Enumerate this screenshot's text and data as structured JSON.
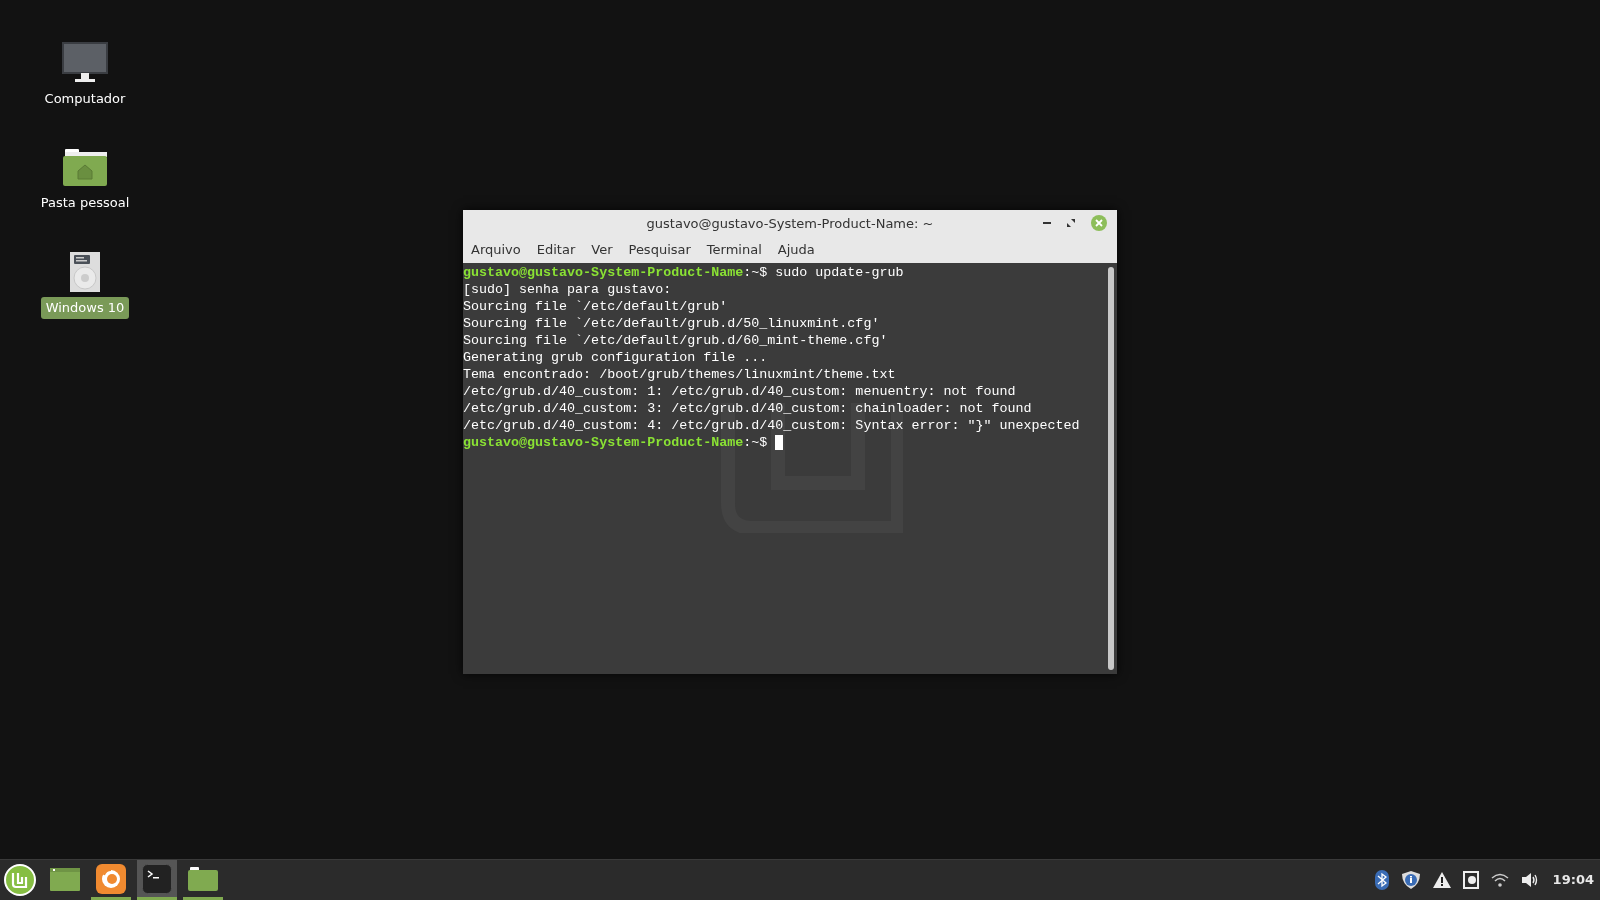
{
  "desktop_icons": [
    {
      "kind": "computer",
      "label": "Computador",
      "selected": false
    },
    {
      "kind": "home",
      "label": "Pasta pessoal",
      "selected": false
    },
    {
      "kind": "drive",
      "label": "Windows 10",
      "selected": true
    }
  ],
  "window": {
    "title": "gustavo@gustavo-System-Product-Name: ~",
    "menu": [
      "Arquivo",
      "Editar",
      "Ver",
      "Pesquisar",
      "Terminal",
      "Ajuda"
    ],
    "lines": [
      {
        "kind": "prompt",
        "user": "gustavo@gustavo-System-Product-Name",
        "path": ":~$ ",
        "command": "sudo update-grub",
        "cursor": false
      },
      {
        "kind": "output",
        "text": "[sudo] senha para gustavo:"
      },
      {
        "kind": "output",
        "text": "Sourcing file `/etc/default/grub'"
      },
      {
        "kind": "output",
        "text": "Sourcing file `/etc/default/grub.d/50_linuxmint.cfg'"
      },
      {
        "kind": "output",
        "text": "Sourcing file `/etc/default/grub.d/60_mint-theme.cfg'"
      },
      {
        "kind": "output",
        "text": "Generating grub configuration file ..."
      },
      {
        "kind": "output",
        "text": "Tema encontrado: /boot/grub/themes/linuxmint/theme.txt"
      },
      {
        "kind": "output",
        "text": "/etc/grub.d/40_custom: 1: /etc/grub.d/40_custom: menuentry: not found"
      },
      {
        "kind": "output",
        "text": "/etc/grub.d/40_custom: 3: /etc/grub.d/40_custom: chainloader: not found"
      },
      {
        "kind": "output",
        "text": "/etc/grub.d/40_custom: 4: /etc/grub.d/40_custom: Syntax error: \"}\" unexpected"
      },
      {
        "kind": "prompt",
        "user": "gustavo@gustavo-System-Product-Name",
        "path": ":~$ ",
        "cursor": true
      }
    ]
  },
  "taskbar": {
    "apps": [
      {
        "kind": "window",
        "running": false,
        "selected": false
      },
      {
        "kind": "browser",
        "running": true,
        "selected": false
      },
      {
        "kind": "terminal",
        "running": true,
        "selected": true
      },
      {
        "kind": "folder",
        "running": true,
        "selected": false
      }
    ],
    "tray": [
      {
        "kind": "bluetooth"
      },
      {
        "kind": "shield"
      },
      {
        "kind": "warning"
      },
      {
        "kind": "drive"
      },
      {
        "kind": "wifi"
      },
      {
        "kind": "volume"
      }
    ],
    "clock": "19:04"
  }
}
